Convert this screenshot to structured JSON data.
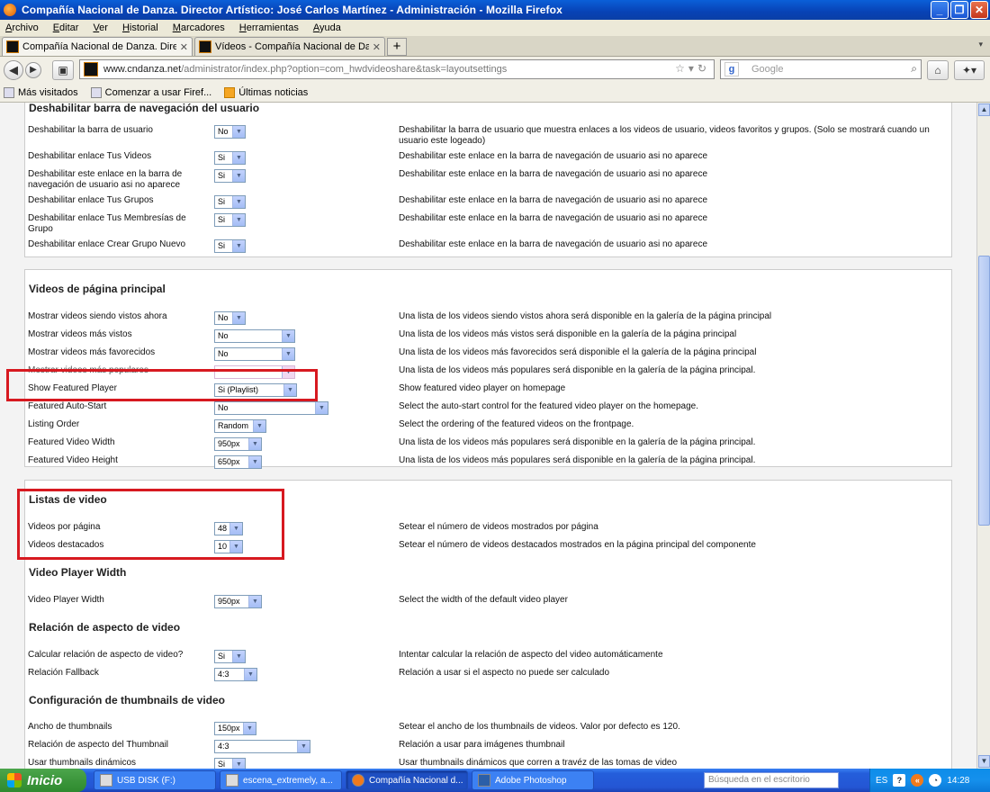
{
  "window": {
    "title": "Compañía Nacional de Danza. Director Artístico: José Carlos Martínez - Administración - Mozilla Firefox"
  },
  "menu": [
    "Archivo",
    "Editar",
    "Ver",
    "Historial",
    "Marcadores",
    "Herramientas",
    "Ayuda"
  ],
  "tabs": [
    {
      "label": "Compañía Nacional de Danza. Director Ar..."
    },
    {
      "label": "Vídeos - Compañía Nacional de Danza. Di..."
    }
  ],
  "nav": {
    "url_domain": "www.cndanza.net",
    "url_path": "/administrator/index.php?option=com_hwdvideoshare&task=layoutsettings",
    "search_placeholder": "Google"
  },
  "bookmarks": [
    "Más visitados",
    "Comenzar a usar Firef...",
    "Últimas noticias"
  ],
  "sections": {
    "user_nav": {
      "title": "Deshabilitar barra de navegación del usuario",
      "rows": [
        {
          "label": "Deshabilitar la barra de usuario",
          "value": "No",
          "desc": "Deshabilitar la barra de usuario que muestra enlaces a los videos de usuario, videos favoritos y grupos. (Solo se mostrará cuando un usuario este logeado)"
        },
        {
          "label": "Deshabilitar enlace Tus Videos",
          "value": "Si",
          "desc": "Deshabilitar este enlace en la barra de navegación de usuario asi no aparece"
        },
        {
          "label": "Deshabilitar este enlace en la barra de navegación de usuario asi no aparece",
          "value": "Si",
          "desc": "Deshabilitar este enlace en la barra de navegación de usuario asi no aparece"
        },
        {
          "label": "Deshabilitar enlace Tus Grupos",
          "value": "Si",
          "desc": "Deshabilitar este enlace en la barra de navegación de usuario asi no aparece"
        },
        {
          "label": "Deshabilitar enlace Tus Membresías de Grupo",
          "value": "Si",
          "desc": "Deshabilitar este enlace en la barra de navegación de usuario asi no aparece"
        },
        {
          "label": "Deshabilitar enlace Crear Grupo Nuevo",
          "value": "Si",
          "desc": "Deshabilitar este enlace en la barra de navegación de usuario asi no aparece"
        }
      ]
    },
    "home_videos": {
      "title": "Videos de página principal",
      "rows": [
        {
          "label": "Mostrar videos siendo vistos ahora",
          "value": "No",
          "desc": "Una lista de los videos siendo vistos ahora será disponible en la galería de la página principal"
        },
        {
          "label": "Mostrar videos más vistos",
          "value": "No",
          "desc": "Una lista de los videos más vistos será disponible en la galería de la página principal"
        },
        {
          "label": "Mostrar videos más favorecidos",
          "value": "No",
          "desc": "Una lista de los videos más favorecidos será disponible el la galería de la página principal"
        },
        {
          "label": "Mostrar videos más populares",
          "value": "",
          "desc": "Una lista de los videos más populares será disponible en la galería de la página principal."
        },
        {
          "label": "Show Featured Player",
          "value": "Si (Playlist)",
          "desc": "Show featured video player on homepage"
        },
        {
          "label": "Featured Auto-Start",
          "value": "No",
          "desc": "Select the auto-start control for the featured video player on the homepage."
        },
        {
          "label": "Listing Order",
          "value": "Random",
          "desc": "Select the ordering of the featured videos on the frontpage."
        },
        {
          "label": "Featured Video Width",
          "value": "950px",
          "desc": "Una lista de los videos más populares será disponible en la galería de la página principal."
        },
        {
          "label": "Featured Video Height",
          "value": "650px",
          "desc": "Una lista de los videos más populares será disponible en la galería de la página principal."
        }
      ]
    },
    "lists": {
      "title": "Listas de video",
      "rows": [
        {
          "label": "Videos por página",
          "value": "48",
          "desc": "Setear el número de videos mostrados por página"
        },
        {
          "label": "Videos destacados",
          "value": "10",
          "desc": "Setear el número de videos destacados mostrados en la página principal del componente"
        }
      ]
    },
    "player_width": {
      "title": "Video Player Width",
      "rows": [
        {
          "label": "Video Player Width",
          "value": "950px",
          "desc": "Select the width of the default video player"
        }
      ]
    },
    "aspect": {
      "title": "Relación de aspecto de video",
      "rows": [
        {
          "label": "Calcular relación de aspecto de video?",
          "value": "Si",
          "desc": "Intentar calcular la relación de aspecto del video automáticamente"
        },
        {
          "label": "Relación Fallback",
          "value": "4:3",
          "desc": "Relación a usar si el aspecto no puede ser calculado"
        }
      ]
    },
    "thumbs": {
      "title": "Configuración de thumbnails de video",
      "rows": [
        {
          "label": "Ancho de thumbnails",
          "value": "150px",
          "desc": "Setear el ancho de los thumbnails de videos. Valor por defecto es 120."
        },
        {
          "label": "Relación de aspecto del Thumbnail",
          "value": "4:3",
          "desc": "Relación a usar para imágenes thumbnail"
        },
        {
          "label": "Usar thumbnails dinámicos",
          "value": "Si",
          "desc": "Usar thumbnails dinámicos que corren a travéz de las tomas de video"
        }
      ]
    }
  },
  "taskbar": {
    "start": "Inicio",
    "tasks": [
      "USB DISK (F:)",
      "escena_extremely, a...",
      "Compañía Nacional d...",
      "Adobe Photoshop"
    ],
    "search_placeholder": "Búsqueda en el escritorio",
    "lang": "ES",
    "time": "14:28"
  }
}
